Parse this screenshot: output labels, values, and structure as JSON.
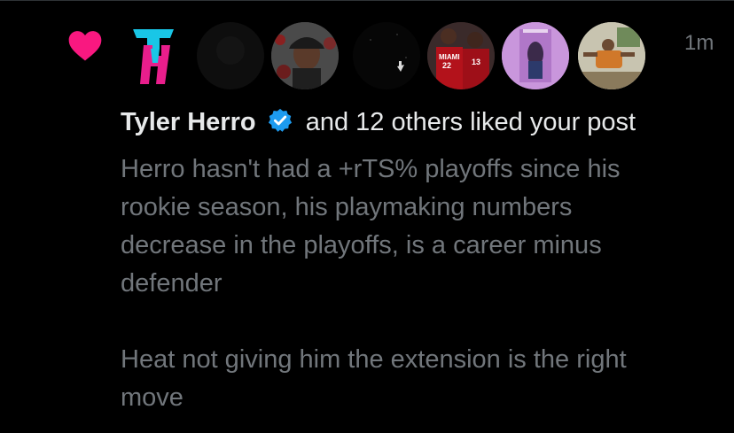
{
  "notification": {
    "liker_name": "Tyler Herro",
    "rest_text": "and 12 others liked your post",
    "time": "1m",
    "post_paragraph_1": "Herro hasn't had a +rTS% playoffs since his\nrookie season, his playmaking numbers\ndecrease in the playoffs, is a career minus\ndefender",
    "post_paragraph_2": "Heat not giving him the extension is the right\nmove"
  },
  "avatars": [
    {
      "icon": "th-logo-avatar"
    },
    {
      "icon": "dark-avatar"
    },
    {
      "icon": "man-cap-avatar"
    },
    {
      "icon": "night-stars-avatar"
    },
    {
      "icon": "heat-players-avatar"
    },
    {
      "icon": "pink-room-avatar"
    },
    {
      "icon": "room-person-avatar"
    }
  ],
  "jersey_text_1": "MIAMI",
  "jersey_number_1": "22",
  "jersey_number_2": "13",
  "colors": {
    "heart": "#f91880",
    "verified": "#1d9bf0",
    "muted_text": "#71767b",
    "primary_text": "#e7e9ea",
    "background": "#000000"
  }
}
